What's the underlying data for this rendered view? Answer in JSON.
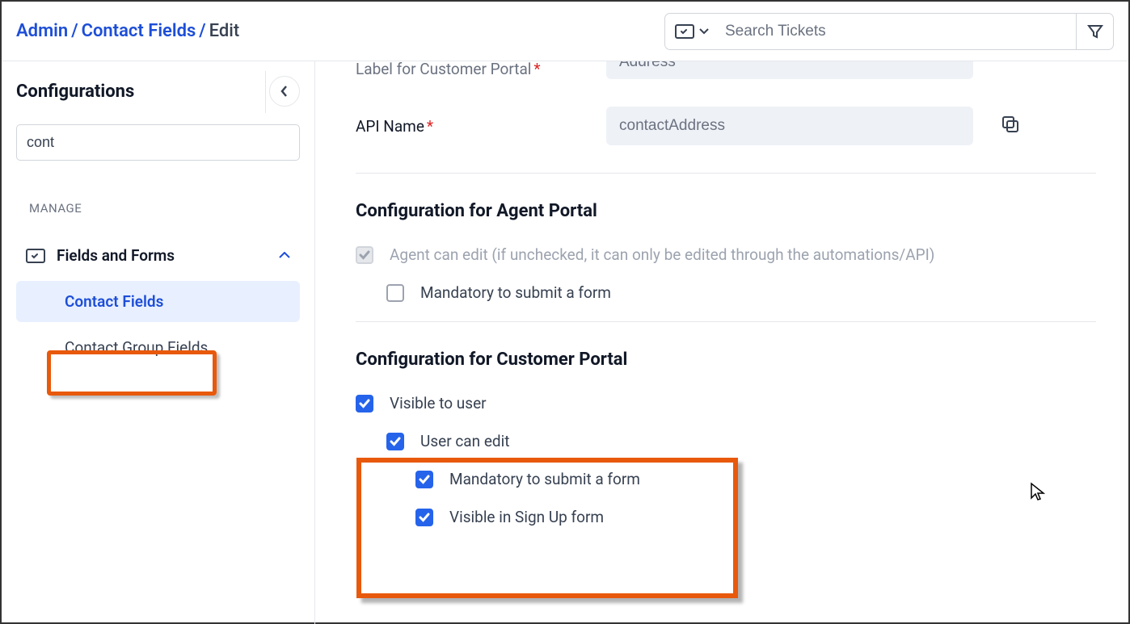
{
  "header": {
    "breadcrumb": {
      "root": "Admin",
      "section": "Contact Fields",
      "current": "Edit"
    },
    "search_placeholder": "Search Tickets"
  },
  "sidebar": {
    "title": "Configurations",
    "search_value": "cont",
    "section_label": "MANAGE",
    "group_label": "Fields and Forms",
    "items": [
      {
        "label": "Contact Fields",
        "active": true
      },
      {
        "label": "Contact Group Fields",
        "active": false
      }
    ]
  },
  "form": {
    "label_customer_portal": {
      "label": "Label for Customer Portal",
      "value": "Address"
    },
    "api_name": {
      "label": "API Name",
      "value": "contactAddress"
    }
  },
  "agent_portal": {
    "title": "Configuration for Agent Portal",
    "agent_can_edit": "Agent can edit (if unchecked, it can only be edited through the automations/API)",
    "mandatory": "Mandatory to submit a form"
  },
  "customer_portal": {
    "title": "Configuration for Customer Portal",
    "visible_to_user": "Visible to user",
    "user_can_edit": "User can edit",
    "mandatory": "Mandatory to submit a form",
    "visible_signup": "Visible in Sign Up form"
  }
}
